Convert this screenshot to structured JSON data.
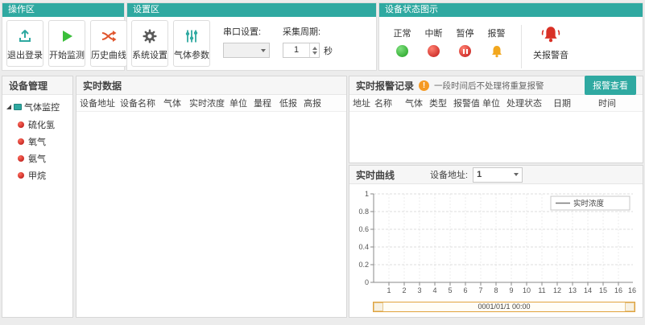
{
  "colors": {
    "accent": "#2fa9a1",
    "ok_green": "#3bbf3b",
    "alert_red": "#d42a2a",
    "warn_amber": "#f2a71f",
    "scroll_orange": "#e0a23c"
  },
  "toolbar": {
    "operation": {
      "title": "操作区",
      "logout": "退出登录",
      "start": "开始监测",
      "history": "历史曲线"
    },
    "settings": {
      "title": "设置区",
      "system": "系统设置",
      "gas": "气体参数",
      "serial_label": "串口设置:",
      "serial_value": "",
      "period_label": "采集周期:",
      "period_value": "1",
      "period_unit": "秒"
    },
    "status": {
      "title": "设备状态图示",
      "normal": "正常",
      "interrupt": "中断",
      "pause": "暂停",
      "alarm": "报警",
      "mute": "关报警音"
    }
  },
  "device_tree": {
    "title": "设备管理",
    "root": "气体监控",
    "items": [
      "硫化氢",
      "氧气",
      "氨气",
      "甲烷"
    ]
  },
  "realtime_data": {
    "title": "实时数据",
    "columns": [
      "设备地址",
      "设备名称",
      "气体",
      "实时浓度",
      "单位",
      "量程",
      "低报",
      "高报"
    ],
    "rows": []
  },
  "alarm_log": {
    "title": "实时报警记录",
    "info_glyph": "!",
    "notice": "一段时间后不处理将重复报警",
    "view_button": "报警查看",
    "columns": [
      "地址",
      "名称",
      "气体",
      "类型",
      "报警值",
      "单位",
      "处理状态",
      "日期",
      "时间"
    ],
    "rows": []
  },
  "curve": {
    "title": "实时曲线",
    "device_label": "设备地址:",
    "device_value": "1",
    "chart_data": {
      "type": "line",
      "series": [
        {
          "name": "实时浓度",
          "values": []
        }
      ],
      "x_ticks": [
        "1",
        "2",
        "3",
        "4",
        "5",
        "6",
        "7",
        "8",
        "9",
        "10",
        "11",
        "12",
        "13",
        "14",
        "15",
        "16"
      ],
      "x_end_label": "16",
      "y_ticks": [
        "0",
        "0.2",
        "0.4",
        "0.6",
        "0.8",
        "1"
      ],
      "ylim": [
        0,
        1
      ],
      "x_axis_label": "0001/01/1  00:00",
      "legend_position": "top-right",
      "grid": true
    }
  }
}
